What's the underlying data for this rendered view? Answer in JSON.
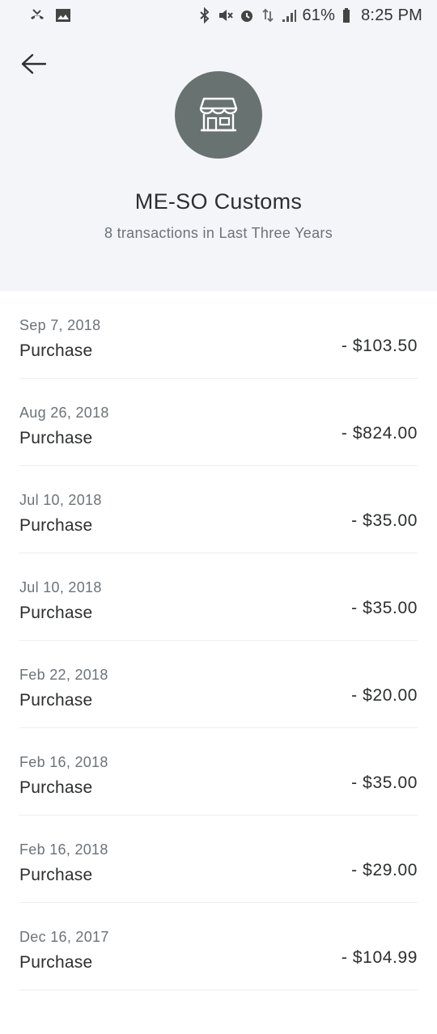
{
  "status_bar": {
    "battery": "61%",
    "time": "8:25 PM",
    "icons": [
      "missed-call-icon",
      "image-icon",
      "bluetooth-icon",
      "mute-icon",
      "alarm-icon",
      "data-icon",
      "signal-icon",
      "battery-icon"
    ]
  },
  "header": {
    "back_icon": "arrow-left-icon",
    "merchant_icon": "storefront-icon",
    "merchant_name": "ME-SO Customs",
    "subtitle": "8 transactions in Last Three Years"
  },
  "transactions": [
    {
      "date": "Sep 7, 2018",
      "type": "Purchase",
      "amount": "- $103.50"
    },
    {
      "date": "Aug 26, 2018",
      "type": "Purchase",
      "amount": "- $824.00"
    },
    {
      "date": "Jul 10, 2018",
      "type": "Purchase",
      "amount": "- $35.00"
    },
    {
      "date": "Jul 10, 2018",
      "type": "Purchase",
      "amount": "- $35.00"
    },
    {
      "date": "Feb 22, 2018",
      "type": "Purchase",
      "amount": "- $20.00"
    },
    {
      "date": "Feb 16, 2018",
      "type": "Purchase",
      "amount": "- $35.00"
    },
    {
      "date": "Feb 16, 2018",
      "type": "Purchase",
      "amount": "- $29.00"
    },
    {
      "date": "Dec 16, 2017",
      "type": "Purchase",
      "amount": "- $104.99"
    }
  ],
  "colors": {
    "header_bg": "#f4f5f9",
    "avatar_bg": "#687271",
    "primary_text": "#2c2e2f",
    "secondary_text": "#6c7378"
  }
}
